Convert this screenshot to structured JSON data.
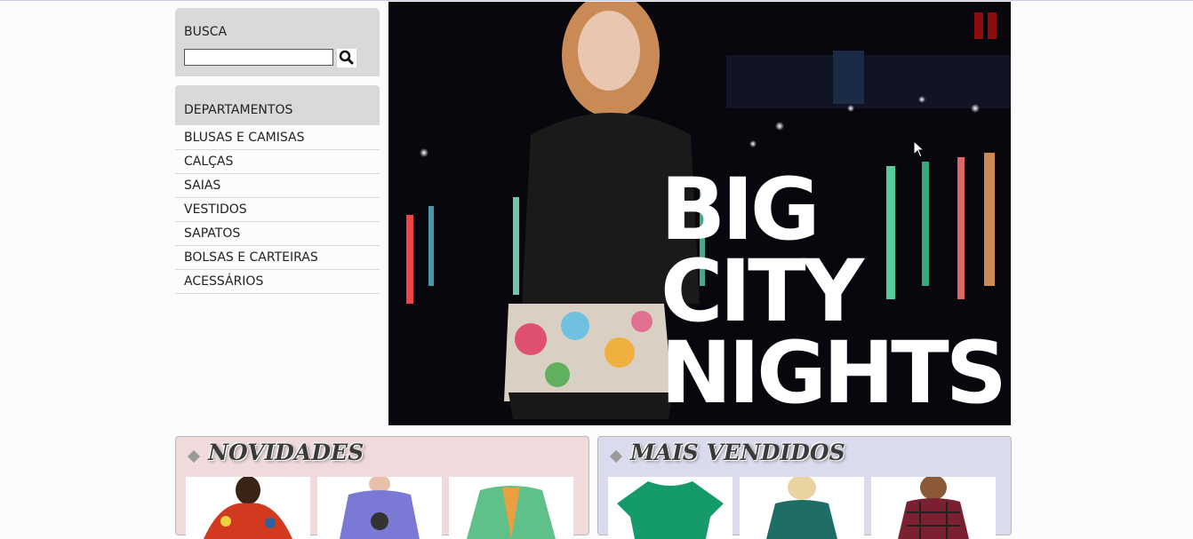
{
  "search": {
    "title": "BUSCA",
    "value": "",
    "button_icon": "search-icon"
  },
  "departments": {
    "title": "DEPARTAMENTOS",
    "items": [
      {
        "label": "BLUSAS E CAMISAS"
      },
      {
        "label": "CALÇAS"
      },
      {
        "label": "SAIAS"
      },
      {
        "label": "VESTIDOS"
      },
      {
        "label": "SAPATOS"
      },
      {
        "label": "BOLSAS E CARTEIRAS"
      },
      {
        "label": "ACESSÁRIOS"
      }
    ]
  },
  "banner": {
    "lines": [
      "BIG",
      "CITY",
      "NIGHTS"
    ],
    "pause_color": "#8d0d0d"
  },
  "sections": {
    "novidades": {
      "title": "NOVIDADES",
      "color": "#f0dadb"
    },
    "mais_vendidos": {
      "title": "MAIS VENDIDOS",
      "color": "#dadbed"
    }
  }
}
